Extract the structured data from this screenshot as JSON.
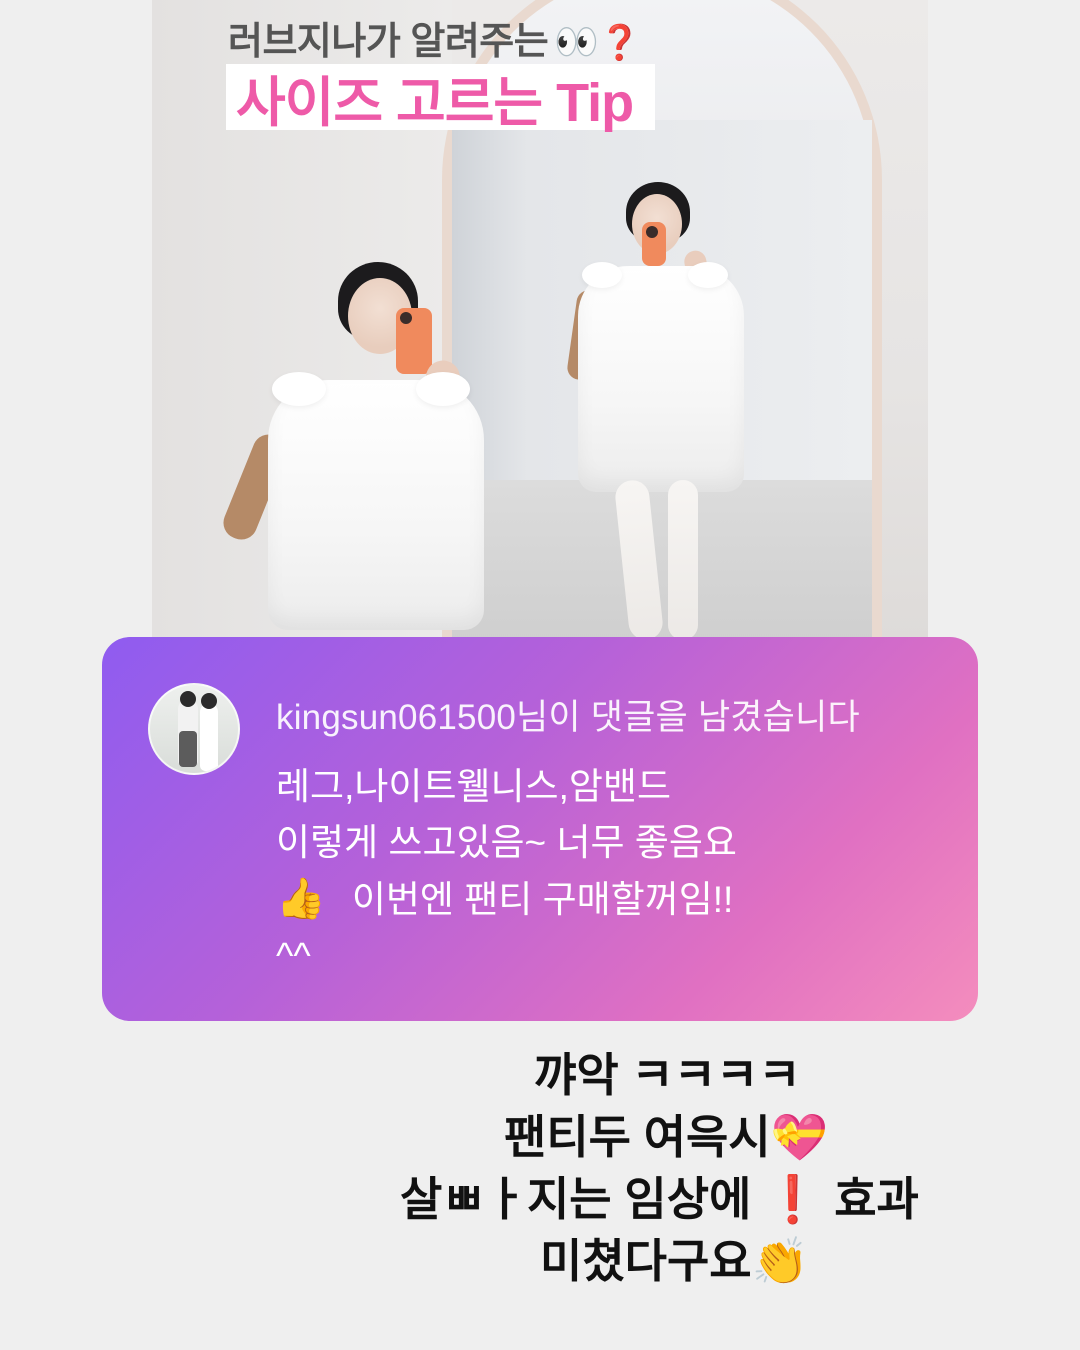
{
  "post": {
    "headline_line1": "러브지나가 알려주는",
    "headline_line1_icons": [
      "eyes-icon",
      "red-question-icon"
    ],
    "eyes_glyph": "👀",
    "question_glyph": "❓",
    "headline_line2": "사이즈 고르는 Tip",
    "headline_color": "#ee5aa8"
  },
  "comment": {
    "meta": "kingsun061500님이 댓글을 남겼습니다",
    "body_line1": "레그,나이트웰니스,암밴드",
    "body_line2": "이렇게 쓰고있음~ 너무 좋음요",
    "thumbs_glyph": "👍",
    "body_line3": "이번엔 팬티 구매할꺼임!!",
    "body_line4": "^^",
    "gradient_colors": [
      "#8f5cf0",
      "#b561d9",
      "#e070c2",
      "#f48dbd"
    ]
  },
  "caption": {
    "line1": "꺄악 ㅋㅋㅋㅋ",
    "line2": "팬티두 여윽시",
    "line2_emoji": "💝",
    "line3_a": "살ㅃㅏ지는 임상에",
    "line3_emoji": "❗",
    "line3_b": "효과",
    "line4": "미쳤다구요",
    "line4_emoji": "👏"
  }
}
